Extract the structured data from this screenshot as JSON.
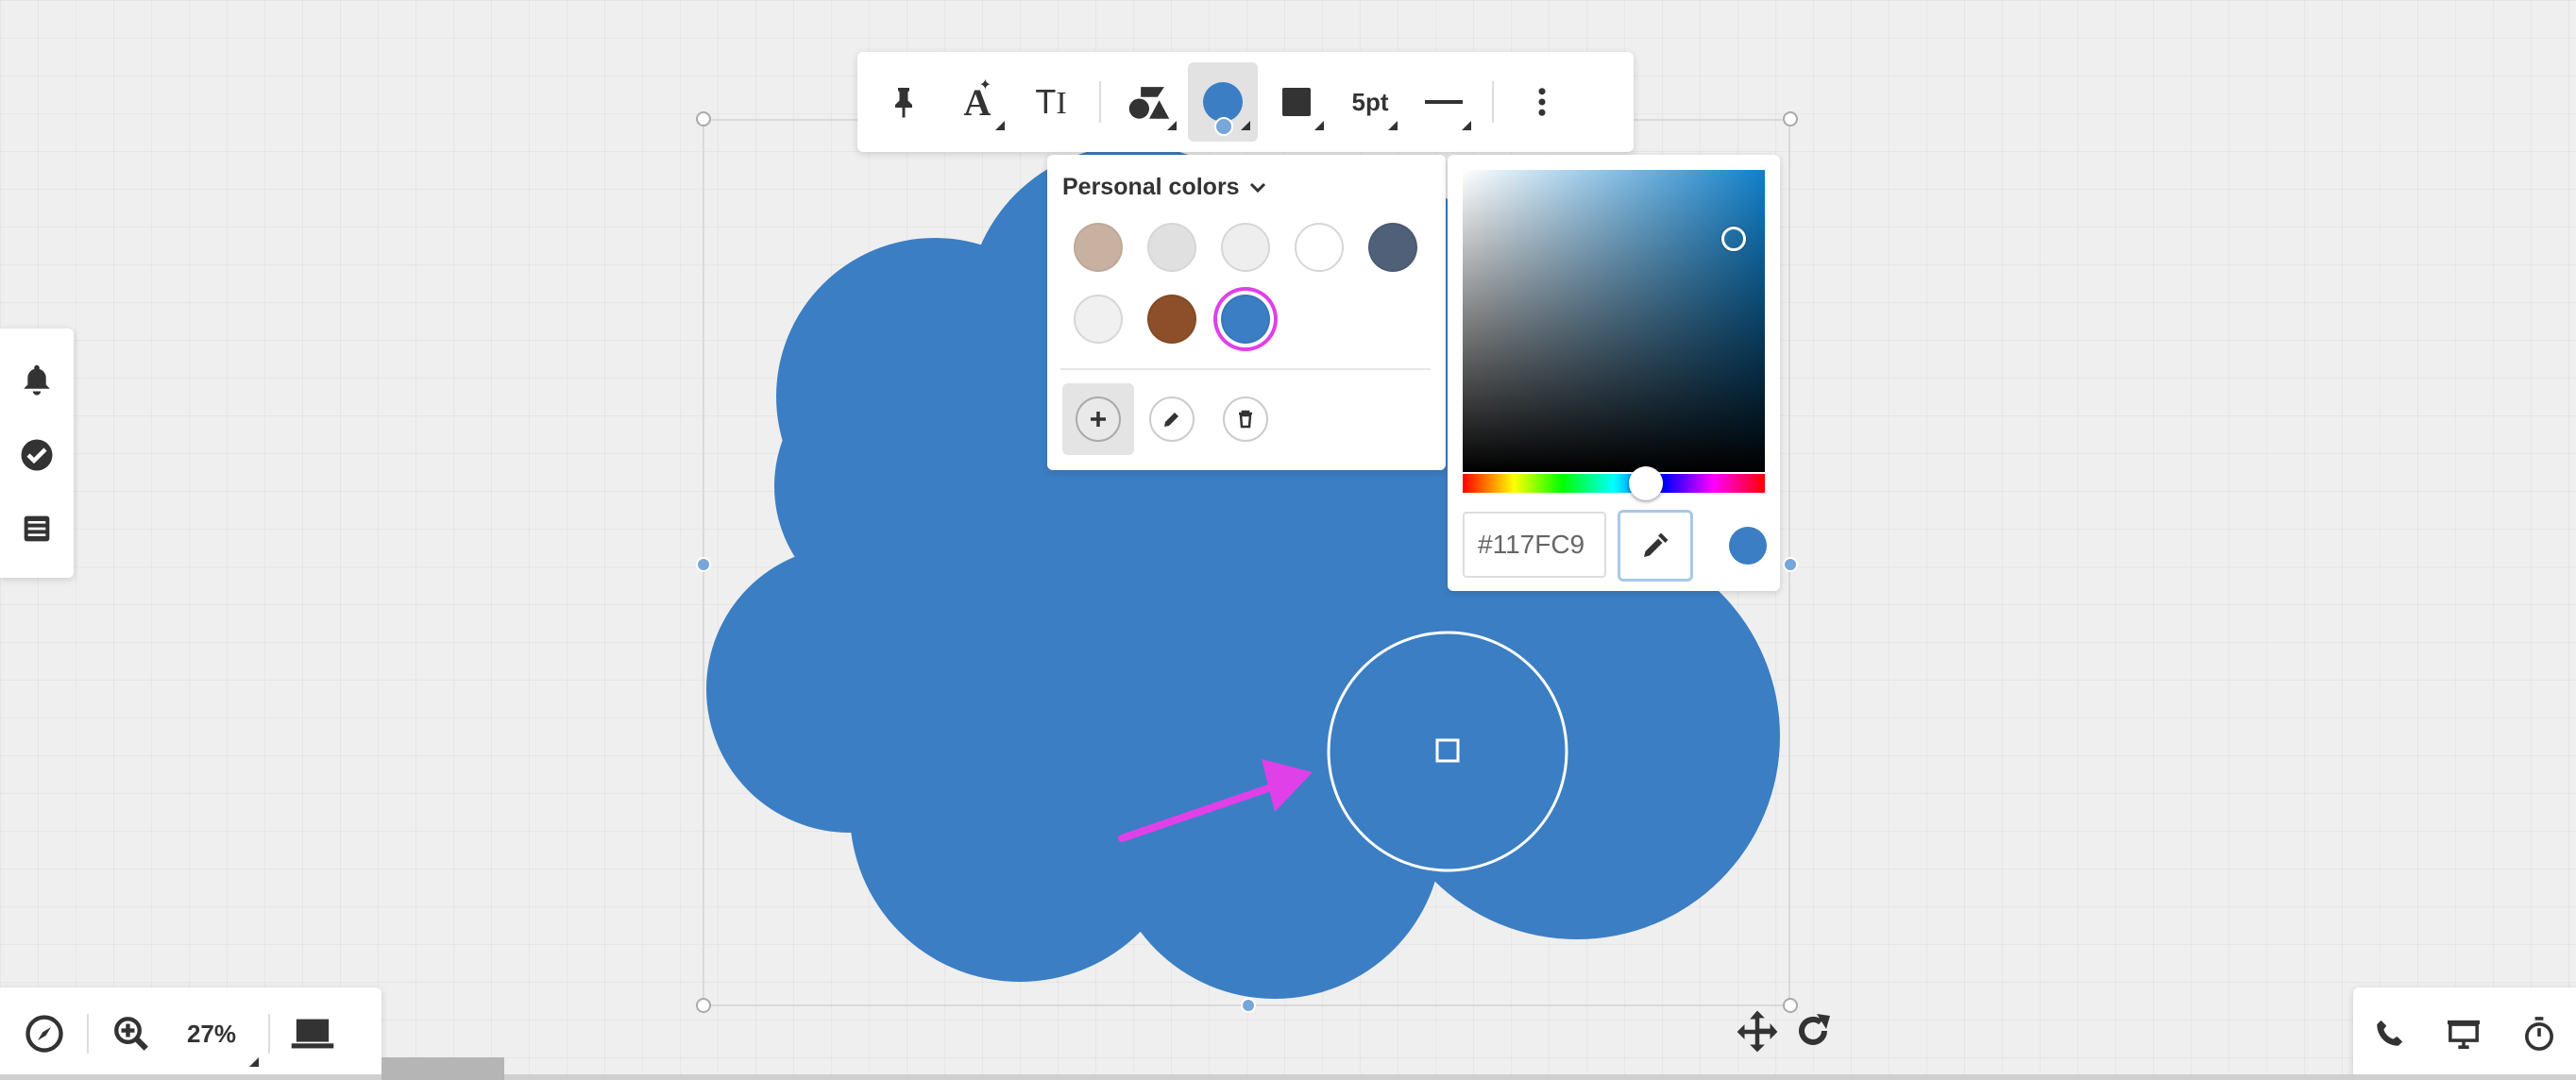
{
  "toolbar": {
    "pin": "pin-icon",
    "text_effects": "text-effects-icon",
    "text_style": "text-style-icon",
    "shape": "shape-icon",
    "fill_color": "#3b7ec4",
    "border_color": "#333333",
    "border_width_label": "5pt",
    "line_style": "line-style-icon",
    "more": "more-icon"
  },
  "personal_colors": {
    "title": "Personal colors",
    "swatches": [
      "#c9b1a1",
      "#e0e0e0",
      "#eeeeee",
      "#ffffff",
      "#4f6078",
      "#f0f0f0",
      "#8c4f2a",
      "#3b7ec4"
    ],
    "selected_index": 7
  },
  "color_picker": {
    "hex_value": "#117FC9",
    "preview_color": "#3b7ec4"
  },
  "zoom": {
    "value": "27%"
  },
  "canvas": {
    "shape_color": "#3b7ec4",
    "annotation_color": "#e040e8"
  }
}
